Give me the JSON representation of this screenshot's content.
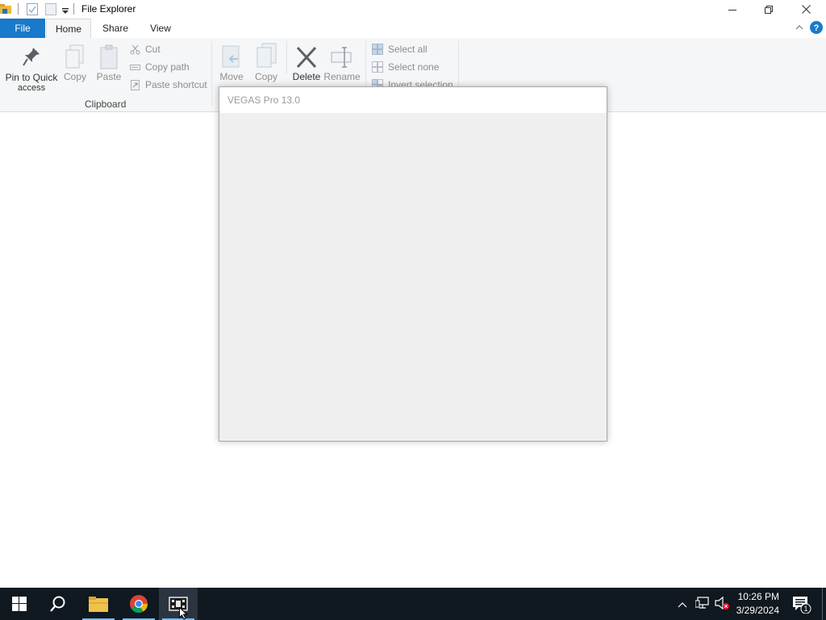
{
  "window": {
    "title": "File Explorer",
    "minimize_icon": "minimize-icon",
    "maximize_icon": "restore-icon",
    "close_icon": "close-icon"
  },
  "tabs": {
    "file": "File",
    "home": "Home",
    "share": "Share",
    "view": "View"
  },
  "ribbon": {
    "clipboard": {
      "pin_line1": "Pin to Quick",
      "pin_line2": "access",
      "copy": "Copy",
      "paste": "Paste",
      "cut": "Cut",
      "copy_path": "Copy path",
      "paste_shortcut": "Paste shortcut",
      "group_label": "Clipboard"
    },
    "organize": {
      "move_to": "Move",
      "copy_to": "Copy",
      "delete": "Delete",
      "rename": "Rename"
    },
    "select": {
      "select_all": "Select all",
      "select_none": "Select none",
      "invert_selection": "Invert selection"
    }
  },
  "dialog": {
    "title": "VEGAS Pro 13.0"
  },
  "taskbar": {
    "time": "10:26 PM",
    "date": "3/29/2024",
    "notification_count": "1"
  },
  "colors": {
    "file_tab": "#1979ca",
    "taskbar": "#101820",
    "active_underline": "#76b9ed"
  }
}
